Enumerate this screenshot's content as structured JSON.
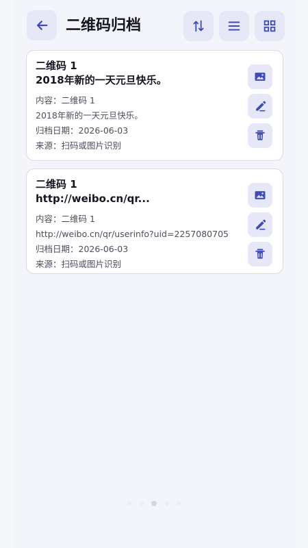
{
  "header": {
    "title": "二维码归档",
    "back_icon": "arrow-left-icon",
    "actions": [
      "sort-icon",
      "list-view-icon",
      "grid-view-icon"
    ]
  },
  "items": [
    {
      "name": "二维码 1",
      "subtitle": "2018年新的一天元旦快乐。",
      "content": "内容：二维码 1",
      "detail_text": "2018年新的一天元旦快乐。",
      "date": "归档日期：2026-06-03",
      "source": "来源：扫码或图片识别",
      "action_icons": [
        "image-icon",
        "edit-icon",
        "delete-icon"
      ]
    },
    {
      "name": "二维码 1",
      "subtitle": "http://weibo.cn/qr...",
      "content": "内容：二维码 1",
      "detail_text": "http://weibo.cn/qr/userinfo?uid=2257080705",
      "date": "归档日期：2026-06-03",
      "source": "来源：扫码或图片识别",
      "action_icons": [
        "image-icon",
        "edit-icon",
        "delete-icon"
      ]
    }
  ],
  "colors": {
    "background": "#f6f7fb",
    "card": "#ffffff",
    "icon_bg": "#e6e8f8",
    "accent": "#404bb5",
    "text": "#15161f"
  },
  "page_indicator": {
    "count": 5,
    "active_index": 2
  }
}
